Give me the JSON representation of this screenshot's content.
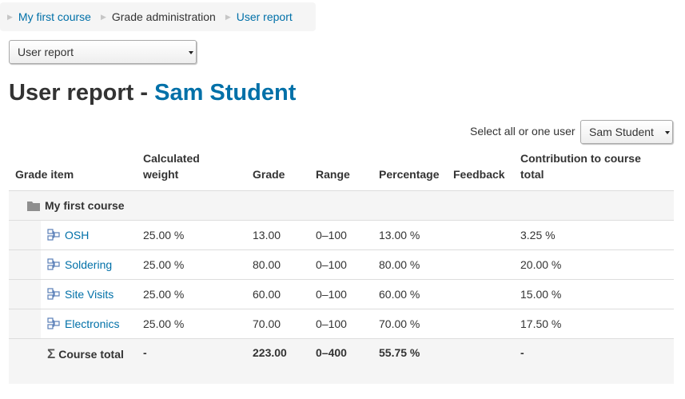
{
  "breadcrumb": {
    "items": [
      {
        "label": "My first course"
      },
      {
        "label": "Grade administration"
      },
      {
        "label": "User report"
      }
    ]
  },
  "report_select": {
    "value": "User report"
  },
  "heading": {
    "prefix": "User report - ",
    "user": "Sam Student"
  },
  "user_filter": {
    "label": "Select all or one user",
    "value": "Sam Student"
  },
  "table": {
    "headers": {
      "grade_item": "Grade item",
      "calculated_weight": "Calculated weight",
      "grade": "Grade",
      "range": "Range",
      "percentage": "Percentage",
      "feedback": "Feedback",
      "contribution": "Contribution to course total"
    },
    "category": {
      "name": "My first course"
    },
    "rows": [
      {
        "name": "OSH",
        "weight": "25.00 %",
        "grade": "13.00",
        "range": "0–100",
        "percentage": "13.00 %",
        "feedback": "",
        "contribution": "3.25 %"
      },
      {
        "name": "Soldering",
        "weight": "25.00 %",
        "grade": "80.00",
        "range": "0–100",
        "percentage": "80.00 %",
        "feedback": "",
        "contribution": "20.00 %"
      },
      {
        "name": "Site Visits",
        "weight": "25.00 %",
        "grade": "60.00",
        "range": "0–100",
        "percentage": "60.00 %",
        "feedback": "",
        "contribution": "15.00 %"
      },
      {
        "name": "Electronics",
        "weight": "25.00 %",
        "grade": "70.00",
        "range": "0–100",
        "percentage": "70.00 %",
        "feedback": "",
        "contribution": "17.50 %"
      }
    ],
    "total": {
      "label": "Course total",
      "weight": "-",
      "grade": "223.00",
      "range": "0–400",
      "percentage": "55.75 %",
      "feedback": "",
      "contribution": "-"
    }
  },
  "colors": {
    "link": "#0070a8",
    "text": "#333333",
    "panel": "#f5f5f5",
    "border": "#dddddd"
  },
  "icons": {
    "category": "folder-icon",
    "item": "grade-item-icon",
    "total": "sigma-icon"
  }
}
